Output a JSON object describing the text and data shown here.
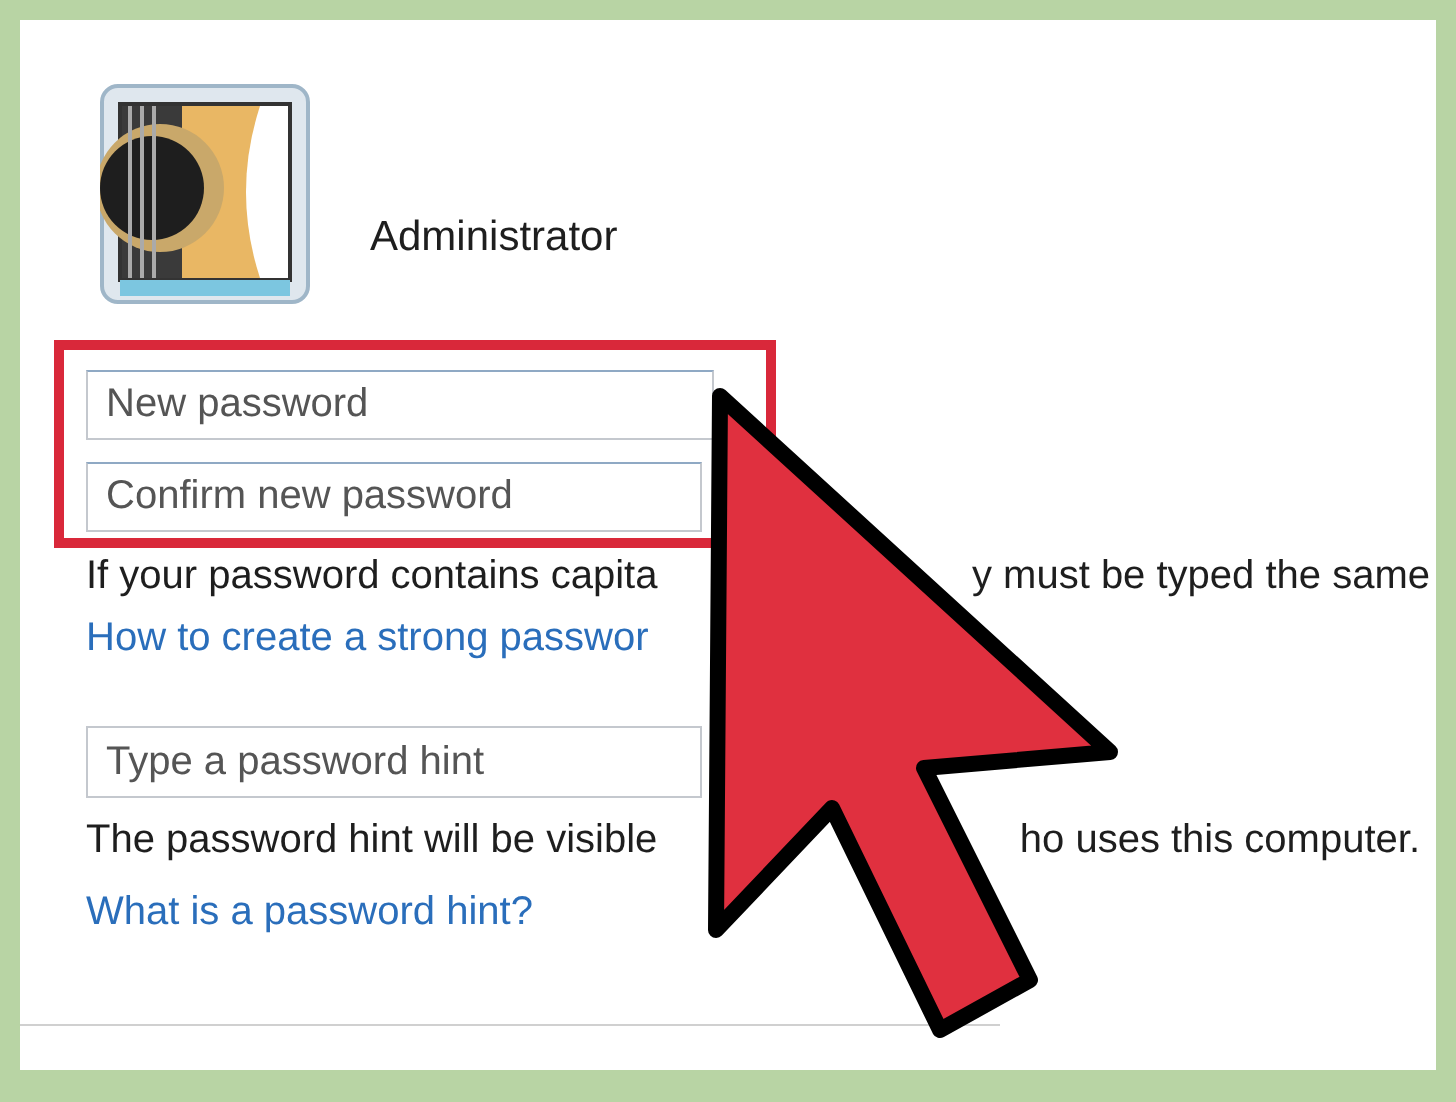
{
  "account_name": "Administrator",
  "password_group": {
    "highlighted": true,
    "fields": [
      {
        "placeholder": "New password"
      },
      {
        "placeholder": "Confirm new password"
      }
    ]
  },
  "case_note": [
    "If your password contains capita",
    "y must be typed the same"
  ],
  "strong_password_link": "How to create a strong passwor",
  "hint_field": {
    "placeholder": "Type a password hint"
  },
  "hint_note": [
    "The password hint will be visible",
    "ho uses this computer."
  ],
  "hint_link": "What is a password hint?"
}
